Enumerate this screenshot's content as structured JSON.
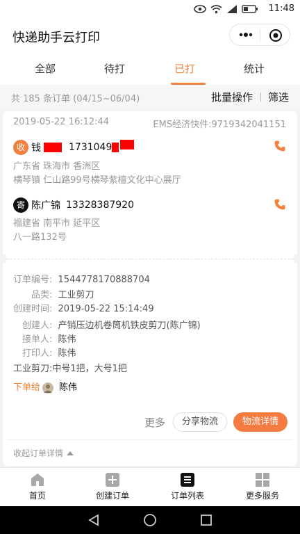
{
  "status_bar": {
    "time": "11:48"
  },
  "app": {
    "title": "快递助手云打印"
  },
  "tabs": [
    {
      "label": "全部"
    },
    {
      "label": "待打"
    },
    {
      "label": "已打"
    },
    {
      "label": "统计"
    }
  ],
  "active_tab": "已打",
  "summary": {
    "count_text": "共 185 条订单 (04/15~06/04)",
    "batch_label": "批量操作",
    "filter_label": "筛选"
  },
  "order": {
    "date": "2019-05-22 16:12:44",
    "carrier": "EMS经济快件:9719342041151",
    "receiver": {
      "badge": "收",
      "name": "钱",
      "phone": "1731049",
      "address_line1": "广东省 珠海市 香洲区",
      "address_line2": "横琴镇 仁山路99号横琴紫檀文化中心展厅"
    },
    "sender": {
      "badge": "寄",
      "name": "陈广锦",
      "phone": "13328387920",
      "address_line1": "福建省 南平市 延平区",
      "address_line2": "八一路132号"
    },
    "details": {
      "order_no_label": "订单编号:",
      "order_no": "1544778170888704",
      "category_label": "品类:",
      "category": "工业剪刀",
      "created_label": "创建时间:",
      "created": "2019-05-22 15:14:49",
      "creator_label": "创建人:",
      "creator": "产销压边机卷筒机铁皮剪刀(陈广锦)",
      "taker_label": "接单人:",
      "taker": "陈伟",
      "printer_label": "打印人:",
      "printer": "陈伟",
      "note": "工业剪刀:中号1把，大号1把",
      "order_to_label": "下单给",
      "order_to": "陈伟"
    },
    "actions": {
      "more": "更多",
      "share": "分享物流",
      "logistics": "物流详情"
    },
    "collapse_label": "收起订单详情"
  },
  "bottom_nav": [
    {
      "label": "首页",
      "icon": "home-icon"
    },
    {
      "label": "创建订单",
      "icon": "plus-square-icon"
    },
    {
      "label": "订单列表",
      "icon": "list-icon"
    },
    {
      "label": "更多服务",
      "icon": "grid-icon"
    }
  ],
  "colors": {
    "accent": "#f5823c",
    "primary_button": "#f47c43"
  }
}
